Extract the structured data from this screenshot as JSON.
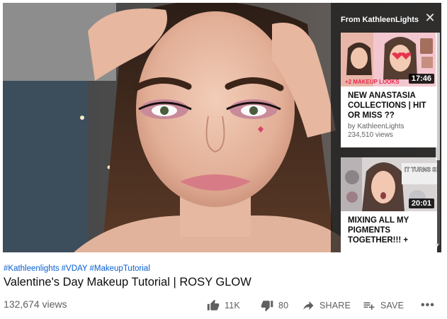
{
  "end_screen": {
    "heading": "From KathleenLights",
    "close_icon": "close-icon",
    "cards": [
      {
        "title": "NEW ANASTASIA COLLECTIONS | HIT OR MISS ??",
        "channel": "by KathleenLights",
        "views": "234,510 views",
        "duration": "17:46",
        "thumb_text": "+2 MAKEUP LOOKS"
      },
      {
        "title": "MIXING ALL MY PIGMENTS TOGETHER!!! +",
        "duration": "20:01",
        "thumb_text": "IT TURNS SILVER?!"
      }
    ]
  },
  "video": {
    "hashtags": [
      "#Kathleenlights",
      "#VDAY",
      "#MakeupTutorial"
    ],
    "title": "Valentine's Day Makeup Tutorial | ROSY GLOW",
    "views": "132,674 views"
  },
  "actions": {
    "like": {
      "icon": "thumbs-up-icon",
      "label": "11K"
    },
    "dislike": {
      "icon": "thumbs-down-icon",
      "label": "80"
    },
    "share": {
      "icon": "share-arrow-icon",
      "label": "SHARE"
    },
    "save": {
      "icon": "playlist-add-icon",
      "label": "SAVE"
    },
    "more": {
      "icon": "more-horizontal-icon",
      "label": "•••"
    }
  },
  "colors": {
    "link": "#065fd4",
    "secondary_text": "#606060",
    "title_text": "#0d0d0d"
  }
}
